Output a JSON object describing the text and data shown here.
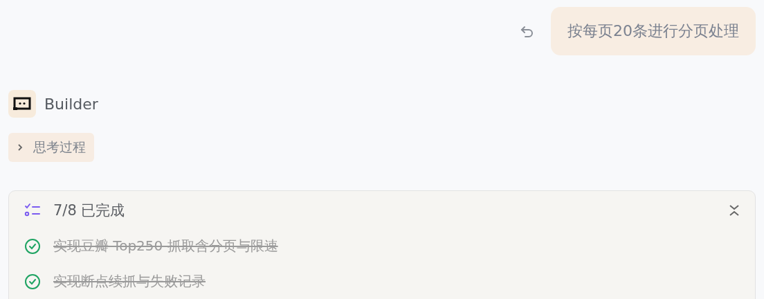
{
  "user_message": {
    "text": "按每页20条进行分页处理"
  },
  "agent": {
    "name": "Builder"
  },
  "thinking": {
    "label": "思考过程",
    "expanded": false
  },
  "todo": {
    "summary": "7/8 已完成",
    "items": [
      {
        "text": "实现豆瓣 Top250 抓取含分页与限速",
        "done": true
      },
      {
        "text": "实现断点续抓与失败记录",
        "done": true
      }
    ]
  }
}
